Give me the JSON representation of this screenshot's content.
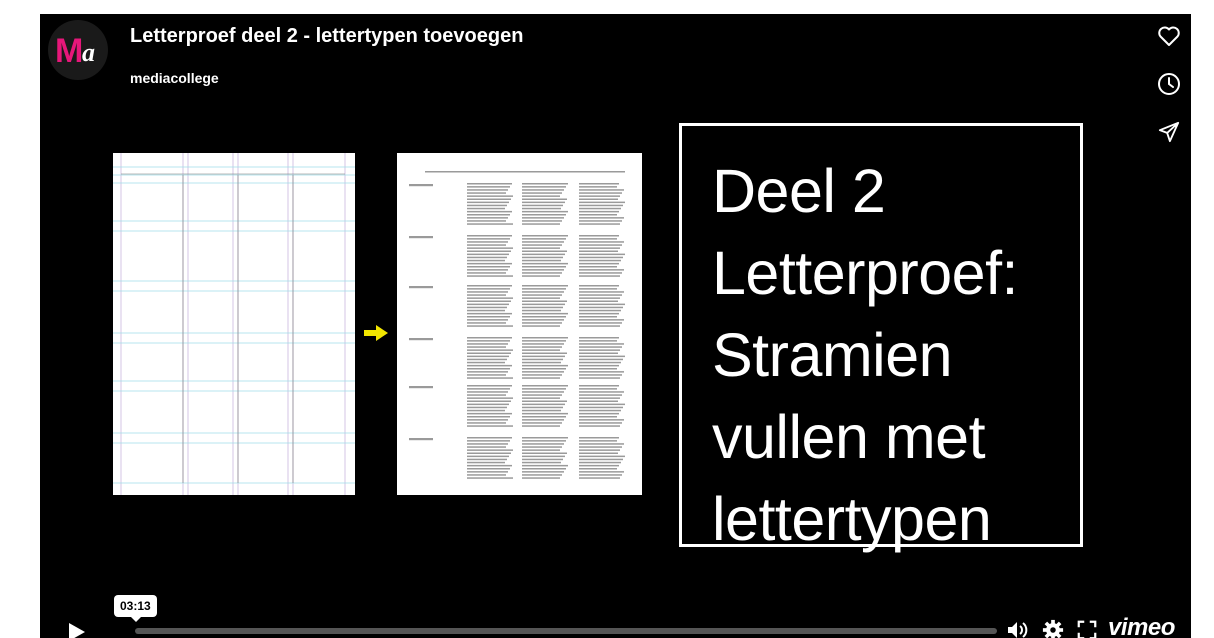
{
  "video": {
    "title": "Letterproef deel 2 - lettertypen toevoegen",
    "channel": "mediacollege",
    "logo_letters": {
      "m": "M",
      "a": "a"
    },
    "logo_color": "#e6177a"
  },
  "side_actions": [
    {
      "name": "like-button",
      "icon": "heart-icon"
    },
    {
      "name": "watch-later-button",
      "icon": "clock-icon"
    },
    {
      "name": "share-button",
      "icon": "send-icon"
    }
  ],
  "slide": {
    "lines": [
      "Deel 2",
      "Letterproef:",
      "Stramien",
      "vullen met",
      "lettertypen"
    ],
    "arrow_color": "#f2e600"
  },
  "controls": {
    "time_tooltip": "03:13",
    "progress": 0.0,
    "brand": "vimeo"
  }
}
